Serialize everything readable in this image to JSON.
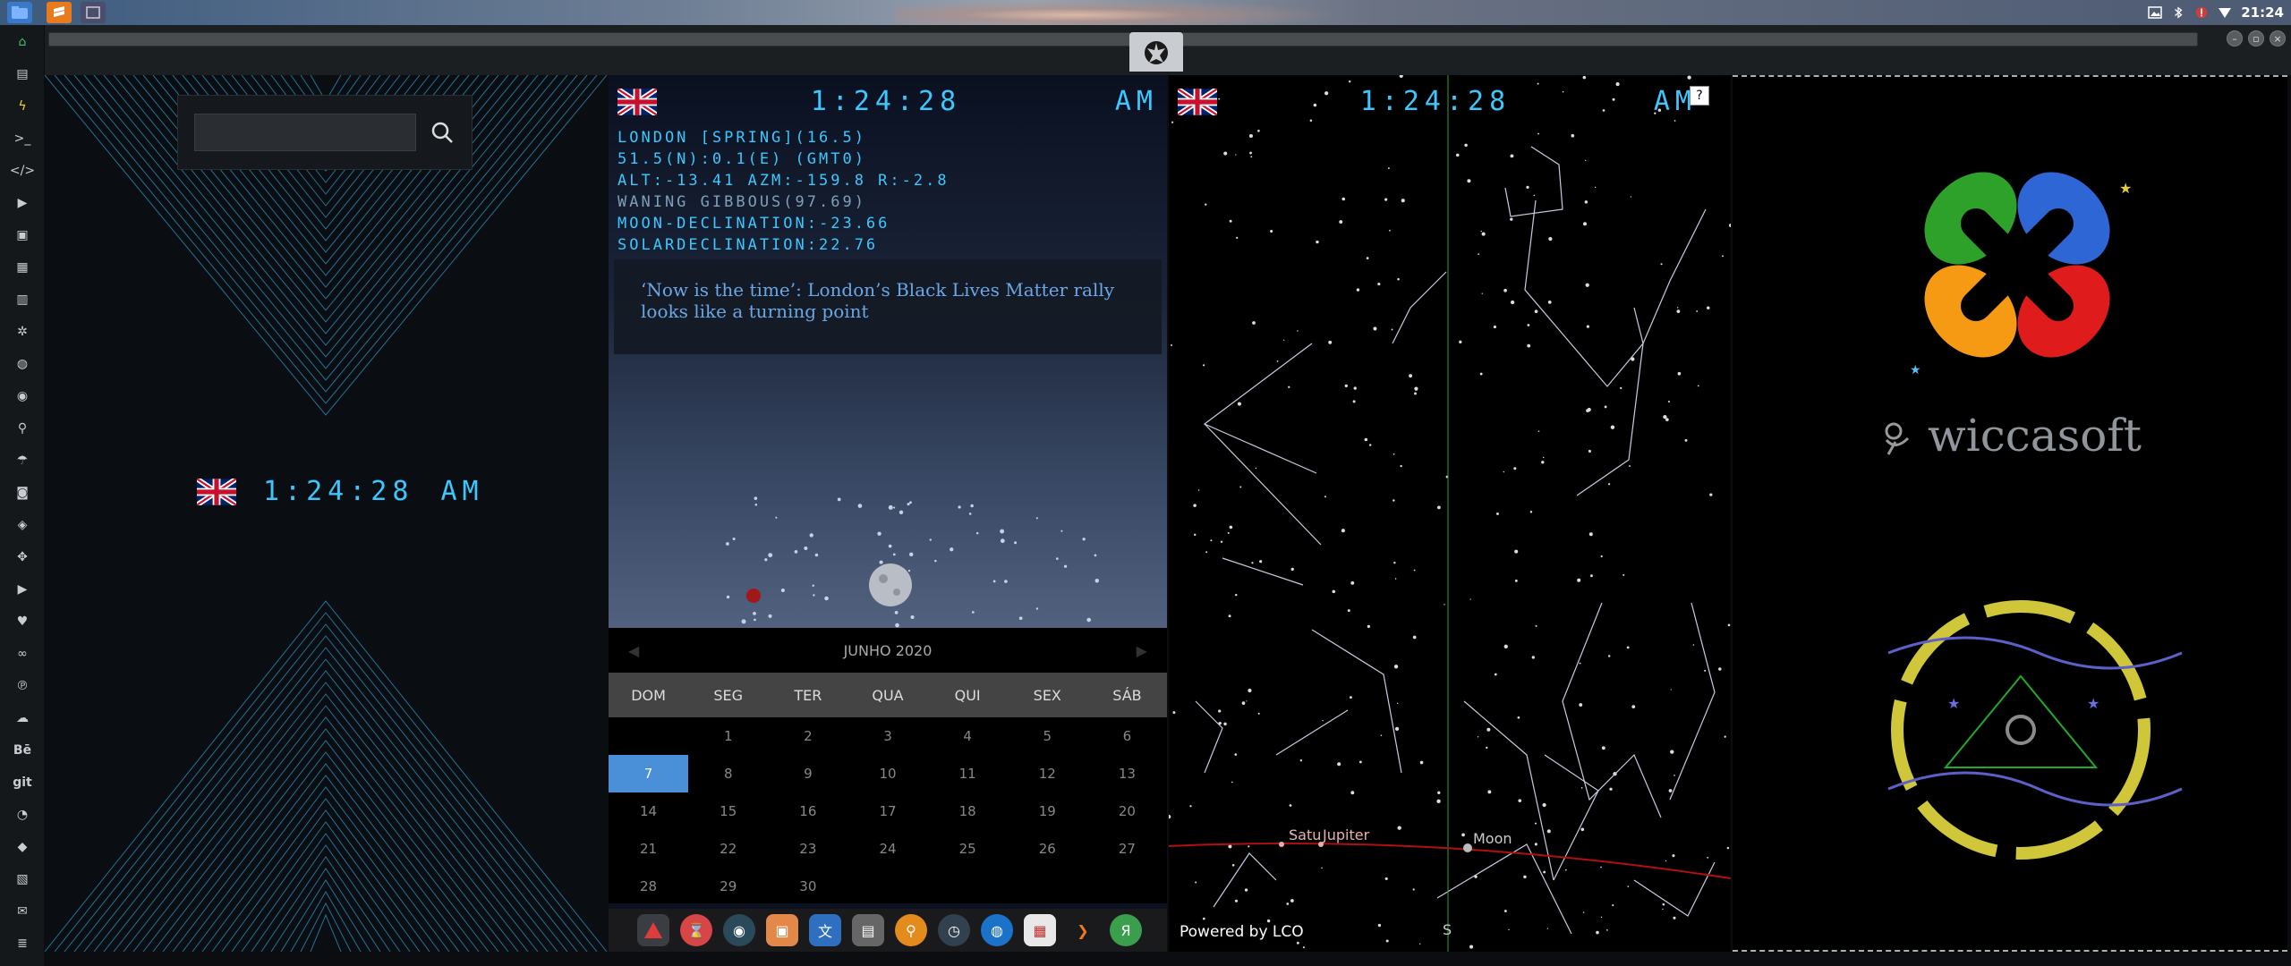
{
  "topbar": {
    "time": "21:24",
    "tray_icons": [
      "image-icon",
      "bluetooth-icon",
      "alert-icon",
      "wifi-icon"
    ]
  },
  "clock": {
    "time": "1:24:28",
    "meridiem": "AM"
  },
  "astro": {
    "lines": [
      "LONDON [SPRING](16.5)",
      "51.5(N):0.1(E) (GMT0)",
      "ALT:-13.41 AZM:-159.8 R:-2.8",
      "WANING GIBBOUS(97.69)",
      "MOON-DECLINATION:-23.66",
      "SOLARDECLINATION:22.76"
    ],
    "news": "‘Now is the time’: London’s Black Lives Matter rally looks like a turning point"
  },
  "calendar": {
    "month": "JUNHO 2020",
    "weekdays": [
      "DOM",
      "SEG",
      "TER",
      "QUA",
      "QUI",
      "SEX",
      "SÁB"
    ],
    "days": [
      "",
      "1",
      "2",
      "3",
      "4",
      "5",
      "6",
      "7",
      "8",
      "9",
      "10",
      "11",
      "12",
      "13",
      "14",
      "15",
      "16",
      "17",
      "18",
      "19",
      "20",
      "21",
      "22",
      "23",
      "24",
      "25",
      "26",
      "27",
      "28",
      "29",
      "30",
      "",
      "",
      "",
      ""
    ],
    "today": "7"
  },
  "sky": {
    "labels": {
      "saturn": "Satu",
      "jupiter": "Jupiter",
      "moon": "Moon",
      "south": "S"
    },
    "powered": "Powered by LCO",
    "help": "?"
  },
  "logo": {
    "brand": "wiccasoft"
  },
  "colors": {
    "clock": "#3cc7ff",
    "today": "#4a90d9",
    "ecliptic": "#b01010"
  }
}
